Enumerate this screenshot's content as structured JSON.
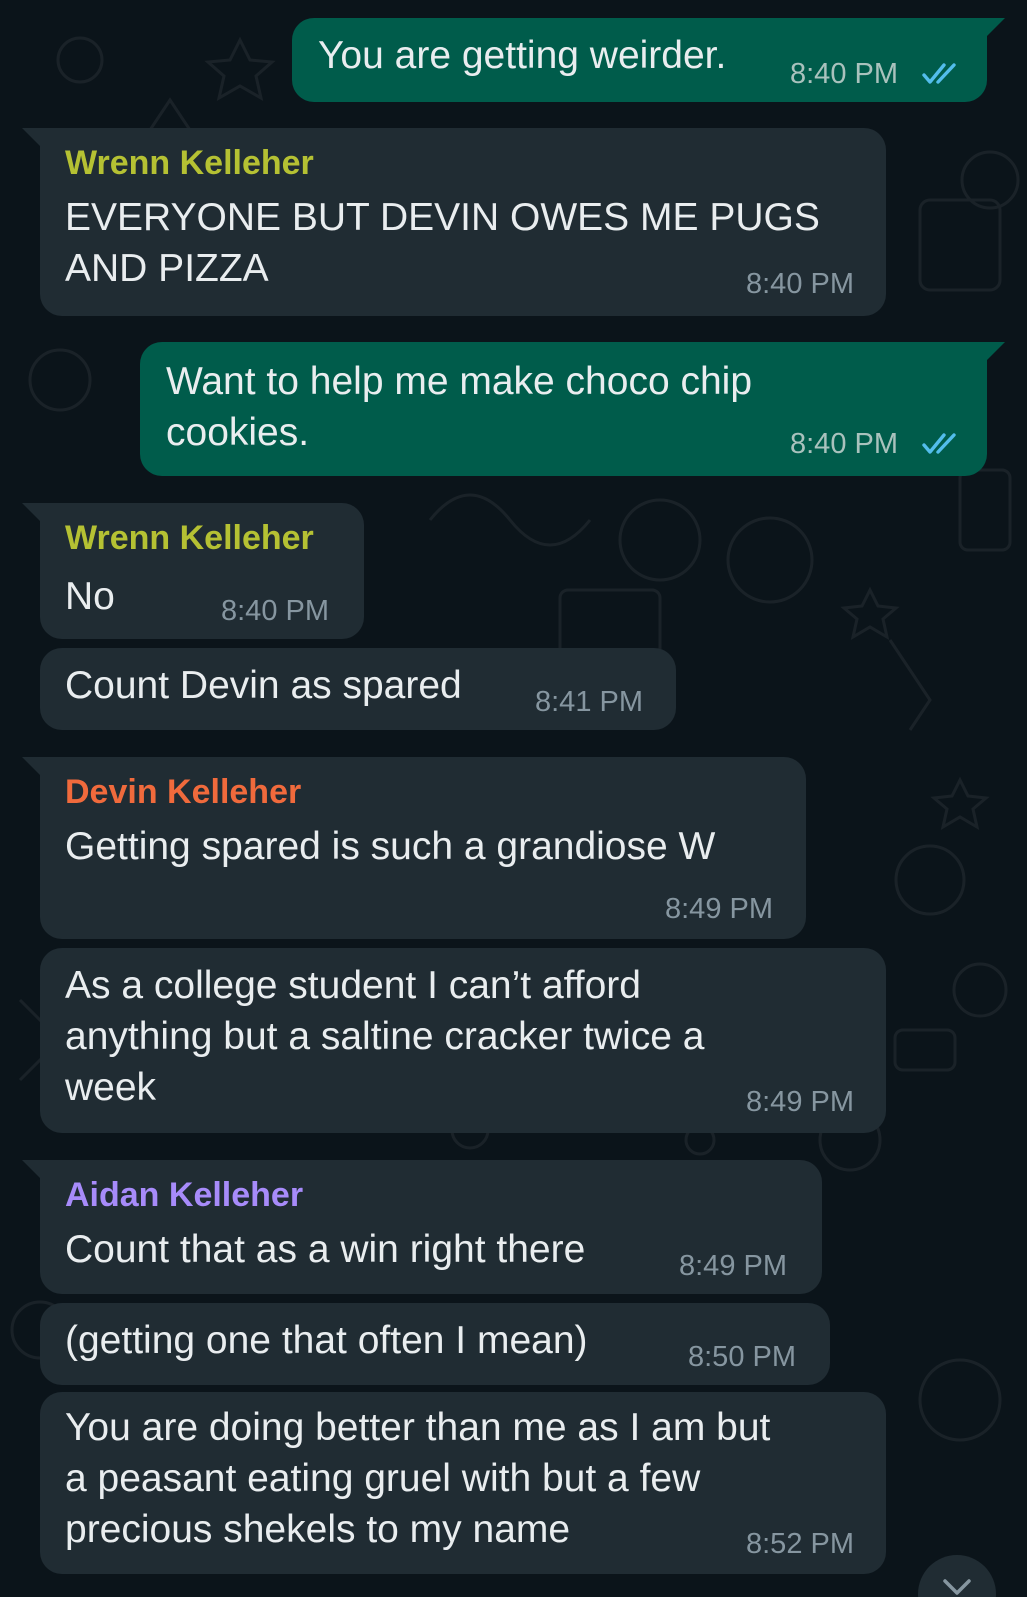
{
  "colors": {
    "background": "#0b141a",
    "incoming_bubble": "#202c33",
    "outgoing_bubble": "#005c4b",
    "text": "#e9edef",
    "timestamp": "#8696a0",
    "read_ticks": "#53bdeb",
    "sender_wrenn": "#b5c133",
    "sender_devin": "#f06a3c",
    "sender_aidan": "#a78bfa"
  },
  "messages": [
    {
      "direction": "out",
      "text": "You are getting weirder.",
      "time": "8:40 PM",
      "status_icon": "double-check-read-icon"
    },
    {
      "direction": "in",
      "sender": "Wrenn Kelleher",
      "lines": [
        "EVERYONE BUT DEVIN OWES ME PUGS",
        "AND PIZZA"
      ],
      "time": "8:40 PM"
    },
    {
      "direction": "out",
      "lines": [
        "Want to help me make choco chip",
        "cookies."
      ],
      "time": "8:40 PM",
      "status_icon": "double-check-read-icon"
    },
    {
      "direction": "in",
      "sender": "Wrenn Kelleher",
      "text": "No",
      "time": "8:40 PM"
    },
    {
      "direction": "in",
      "text": "Count Devin as spared",
      "time": "8:41 PM"
    },
    {
      "direction": "in",
      "sender": "Devin Kelleher",
      "text": "Getting spared is such a grandiose W",
      "time": "8:49 PM"
    },
    {
      "direction": "in",
      "lines": [
        "As a college student I can’t afford",
        "anything but a saltine cracker twice a",
        "week"
      ],
      "time": "8:49 PM"
    },
    {
      "direction": "in",
      "sender": "Aidan Kelleher",
      "text": "Count that as a win right there",
      "time": "8:49 PM"
    },
    {
      "direction": "in",
      "text": "(getting one that often I mean)",
      "time": "8:50 PM"
    },
    {
      "direction": "in",
      "lines": [
        "You are doing better than me as I am but",
        "a peasant eating gruel with but a few",
        "precious shekels to my name"
      ],
      "time": "8:52 PM"
    }
  ],
  "scroll_button_icon": "chevron-down-icon"
}
